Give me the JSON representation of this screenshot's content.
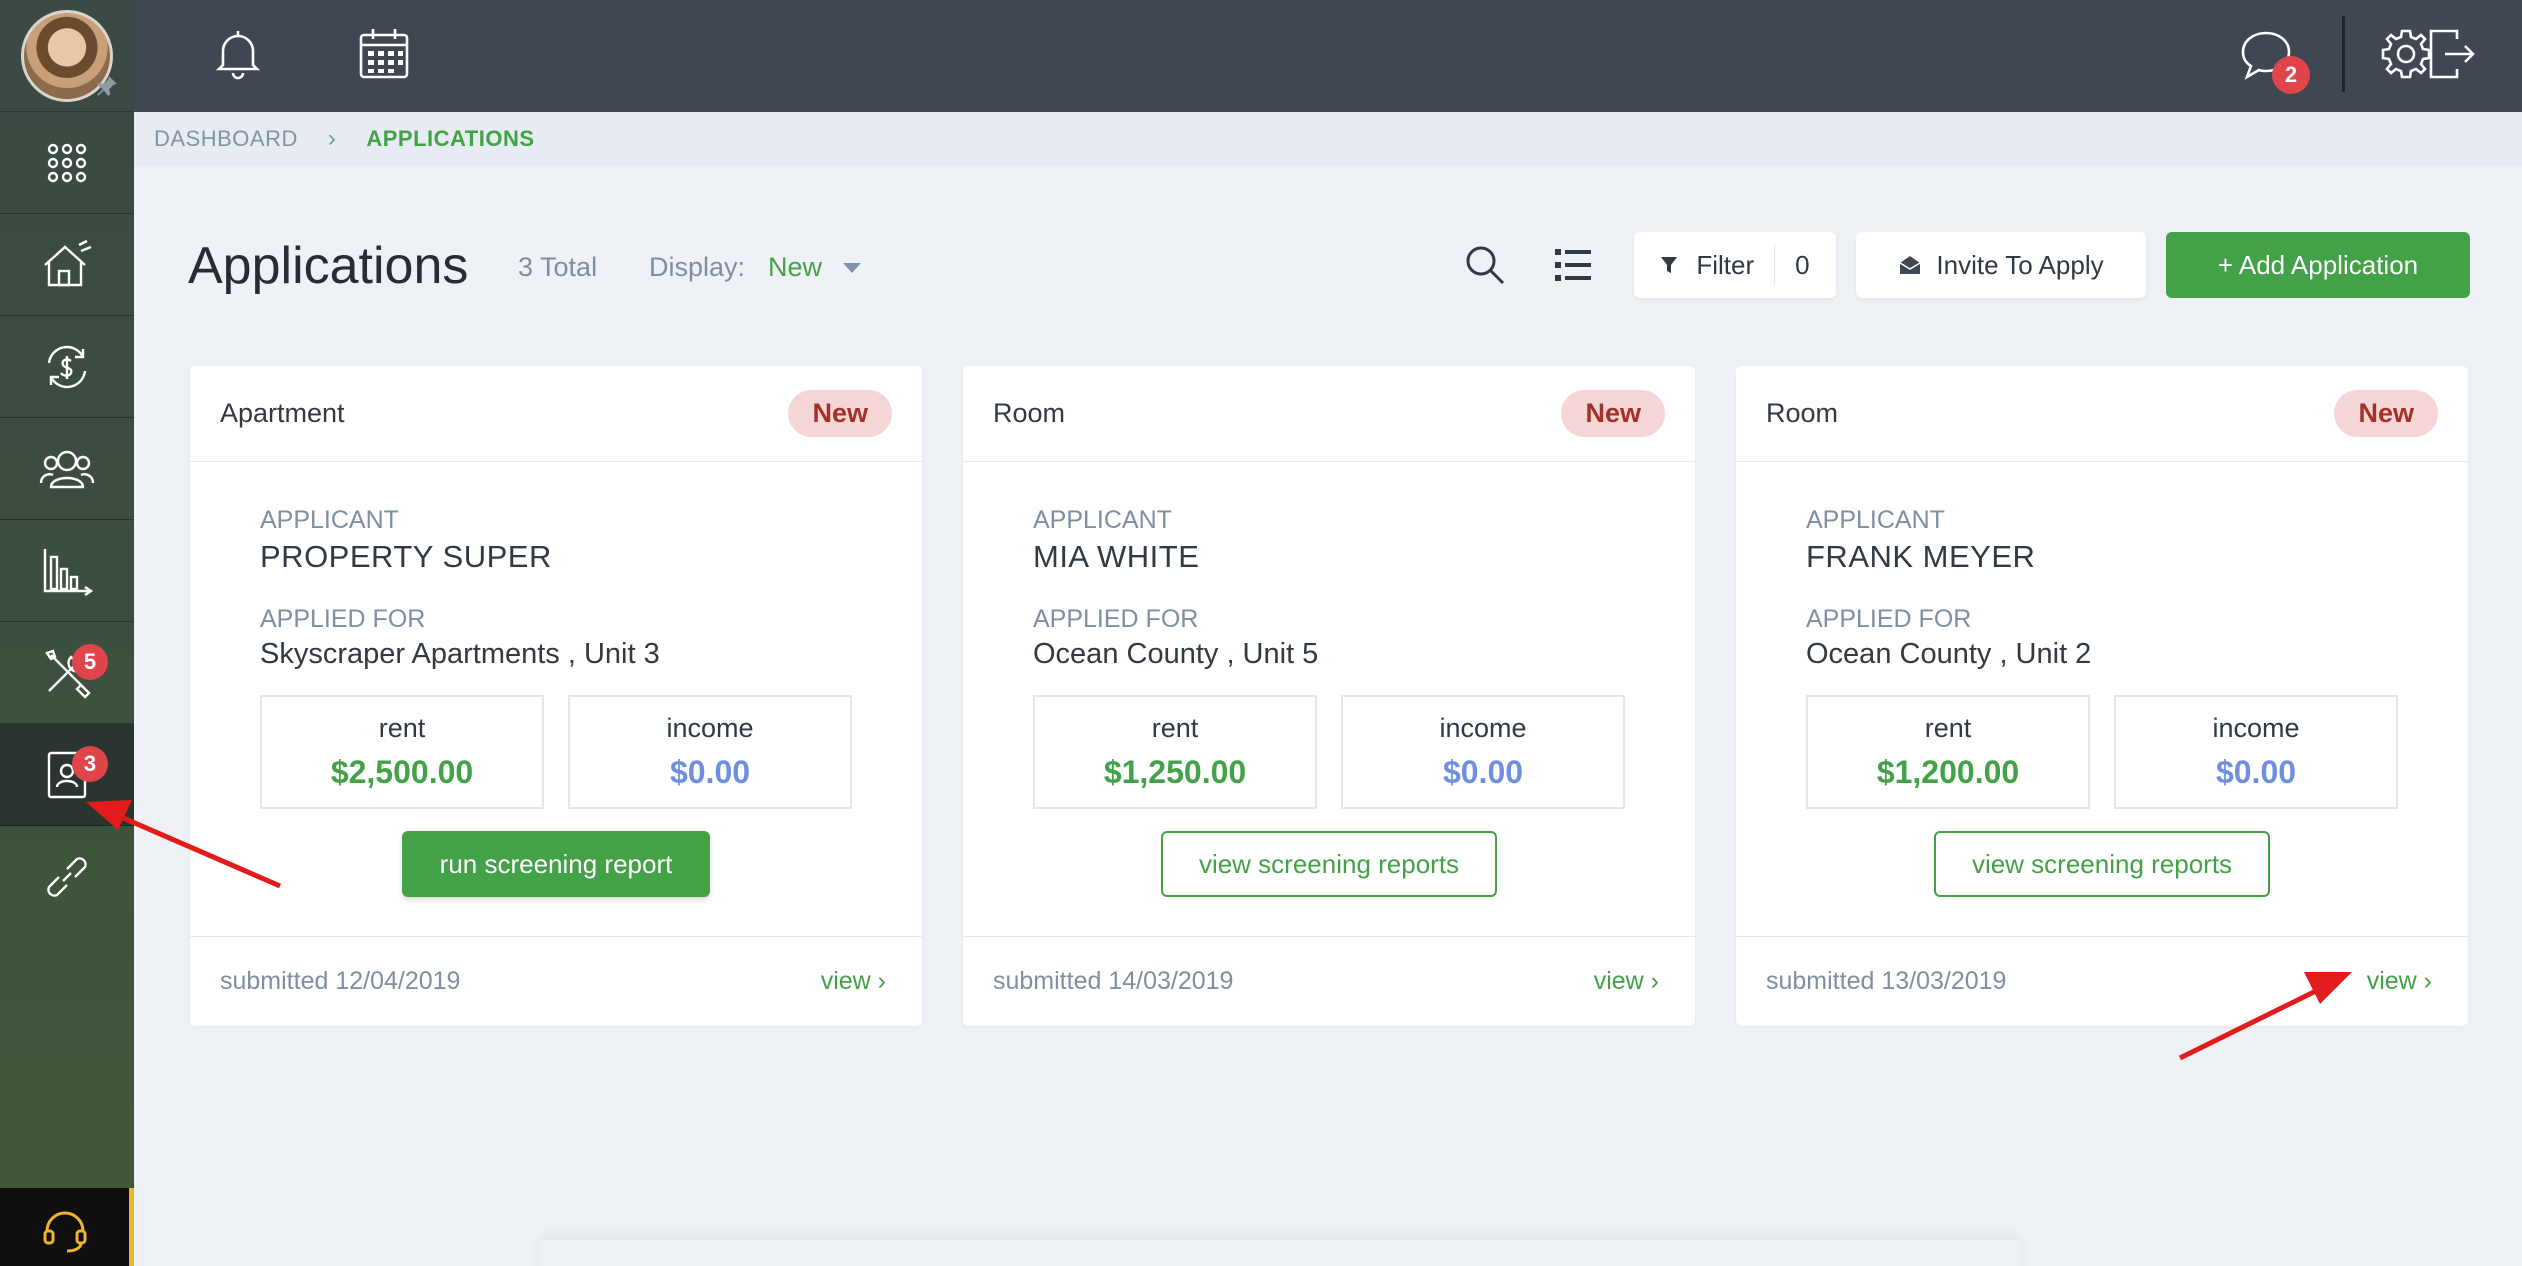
{
  "breadcrumb": {
    "root": "DASHBOARD",
    "current": "APPLICATIONS"
  },
  "header": {
    "title": "Applications",
    "total": "3 Total",
    "display_label": "Display:",
    "display_value": "New",
    "filter_label": "Filter",
    "filter_count": "0",
    "invite_label": "Invite To Apply",
    "add_label": "+ Add Application"
  },
  "topbar": {
    "messages_badge": "2"
  },
  "sidebar": {
    "maintenance_badge": "5",
    "applications_badge": "3"
  },
  "cards": [
    {
      "type": "Apartment",
      "status": "New",
      "applicant_label": "APPLICANT",
      "applicant": "PROPERTY SUPER",
      "applied_label": "APPLIED FOR",
      "applied_for": "Skyscraper Apartments , Unit 3",
      "rent_label": "rent",
      "rent": "$2,500.00",
      "income_label": "income",
      "income": "$0.00",
      "action": "run screening report",
      "submitted": "submitted 12/04/2019",
      "view": "view"
    },
    {
      "type": "Room",
      "status": "New",
      "applicant_label": "APPLICANT",
      "applicant": "MIA WHITE",
      "applied_label": "APPLIED FOR",
      "applied_for": "Ocean County , Unit 5",
      "rent_label": "rent",
      "rent": "$1,250.00",
      "income_label": "income",
      "income": "$0.00",
      "action": "view screening reports",
      "submitted": "submitted 14/03/2019",
      "view": "view"
    },
    {
      "type": "Room",
      "status": "New",
      "applicant_label": "APPLICANT",
      "applicant": "FRANK MEYER",
      "applied_label": "APPLIED FOR",
      "applied_for": "Ocean County , Unit 2",
      "rent_label": "rent",
      "rent": "$1,200.00",
      "income_label": "income",
      "income": "$0.00",
      "action": "view screening reports",
      "submitted": "submitted 13/03/2019",
      "view": "view"
    }
  ],
  "colors": {
    "accent": "#43a148",
    "badge": "#e0454b",
    "income": "#6e8fe0",
    "sidebar": "#3c4d3f",
    "topbar": "#3e4752"
  }
}
